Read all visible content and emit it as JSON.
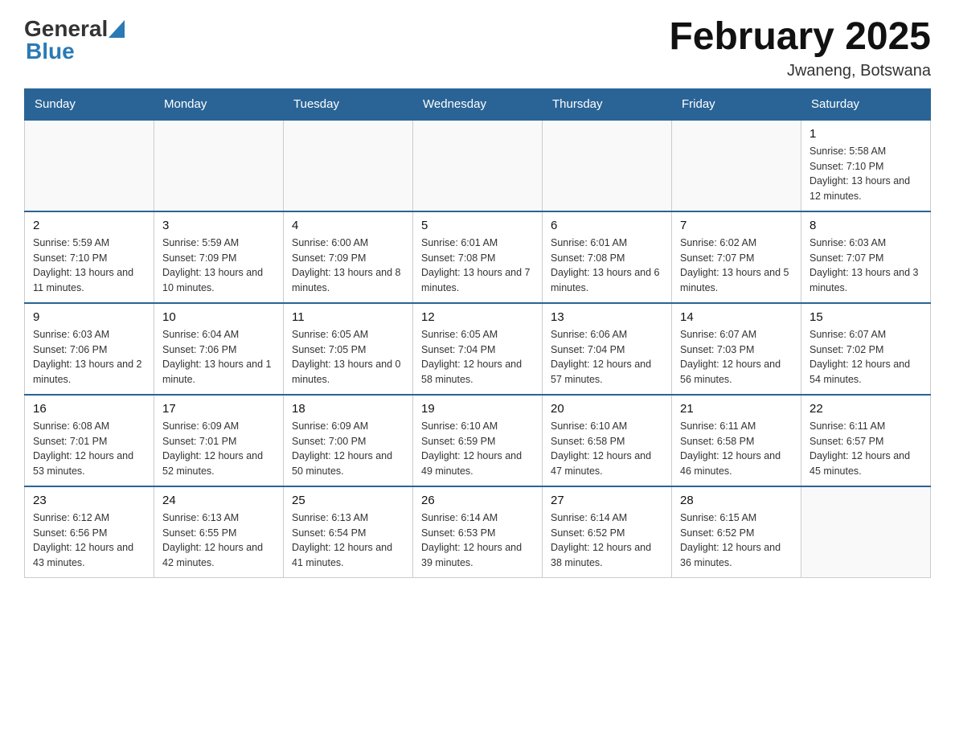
{
  "header": {
    "logo_general": "General",
    "logo_blue": "Blue",
    "title": "February 2025",
    "subtitle": "Jwaneng, Botswana"
  },
  "days_of_week": [
    "Sunday",
    "Monday",
    "Tuesday",
    "Wednesday",
    "Thursday",
    "Friday",
    "Saturday"
  ],
  "weeks": [
    [
      {
        "day": "",
        "info": ""
      },
      {
        "day": "",
        "info": ""
      },
      {
        "day": "",
        "info": ""
      },
      {
        "day": "",
        "info": ""
      },
      {
        "day": "",
        "info": ""
      },
      {
        "day": "",
        "info": ""
      },
      {
        "day": "1",
        "info": "Sunrise: 5:58 AM\nSunset: 7:10 PM\nDaylight: 13 hours and 12 minutes."
      }
    ],
    [
      {
        "day": "2",
        "info": "Sunrise: 5:59 AM\nSunset: 7:10 PM\nDaylight: 13 hours and 11 minutes."
      },
      {
        "day": "3",
        "info": "Sunrise: 5:59 AM\nSunset: 7:09 PM\nDaylight: 13 hours and 10 minutes."
      },
      {
        "day": "4",
        "info": "Sunrise: 6:00 AM\nSunset: 7:09 PM\nDaylight: 13 hours and 8 minutes."
      },
      {
        "day": "5",
        "info": "Sunrise: 6:01 AM\nSunset: 7:08 PM\nDaylight: 13 hours and 7 minutes."
      },
      {
        "day": "6",
        "info": "Sunrise: 6:01 AM\nSunset: 7:08 PM\nDaylight: 13 hours and 6 minutes."
      },
      {
        "day": "7",
        "info": "Sunrise: 6:02 AM\nSunset: 7:07 PM\nDaylight: 13 hours and 5 minutes."
      },
      {
        "day": "8",
        "info": "Sunrise: 6:03 AM\nSunset: 7:07 PM\nDaylight: 13 hours and 3 minutes."
      }
    ],
    [
      {
        "day": "9",
        "info": "Sunrise: 6:03 AM\nSunset: 7:06 PM\nDaylight: 13 hours and 2 minutes."
      },
      {
        "day": "10",
        "info": "Sunrise: 6:04 AM\nSunset: 7:06 PM\nDaylight: 13 hours and 1 minute."
      },
      {
        "day": "11",
        "info": "Sunrise: 6:05 AM\nSunset: 7:05 PM\nDaylight: 13 hours and 0 minutes."
      },
      {
        "day": "12",
        "info": "Sunrise: 6:05 AM\nSunset: 7:04 PM\nDaylight: 12 hours and 58 minutes."
      },
      {
        "day": "13",
        "info": "Sunrise: 6:06 AM\nSunset: 7:04 PM\nDaylight: 12 hours and 57 minutes."
      },
      {
        "day": "14",
        "info": "Sunrise: 6:07 AM\nSunset: 7:03 PM\nDaylight: 12 hours and 56 minutes."
      },
      {
        "day": "15",
        "info": "Sunrise: 6:07 AM\nSunset: 7:02 PM\nDaylight: 12 hours and 54 minutes."
      }
    ],
    [
      {
        "day": "16",
        "info": "Sunrise: 6:08 AM\nSunset: 7:01 PM\nDaylight: 12 hours and 53 minutes."
      },
      {
        "day": "17",
        "info": "Sunrise: 6:09 AM\nSunset: 7:01 PM\nDaylight: 12 hours and 52 minutes."
      },
      {
        "day": "18",
        "info": "Sunrise: 6:09 AM\nSunset: 7:00 PM\nDaylight: 12 hours and 50 minutes."
      },
      {
        "day": "19",
        "info": "Sunrise: 6:10 AM\nSunset: 6:59 PM\nDaylight: 12 hours and 49 minutes."
      },
      {
        "day": "20",
        "info": "Sunrise: 6:10 AM\nSunset: 6:58 PM\nDaylight: 12 hours and 47 minutes."
      },
      {
        "day": "21",
        "info": "Sunrise: 6:11 AM\nSunset: 6:58 PM\nDaylight: 12 hours and 46 minutes."
      },
      {
        "day": "22",
        "info": "Sunrise: 6:11 AM\nSunset: 6:57 PM\nDaylight: 12 hours and 45 minutes."
      }
    ],
    [
      {
        "day": "23",
        "info": "Sunrise: 6:12 AM\nSunset: 6:56 PM\nDaylight: 12 hours and 43 minutes."
      },
      {
        "day": "24",
        "info": "Sunrise: 6:13 AM\nSunset: 6:55 PM\nDaylight: 12 hours and 42 minutes."
      },
      {
        "day": "25",
        "info": "Sunrise: 6:13 AM\nSunset: 6:54 PM\nDaylight: 12 hours and 41 minutes."
      },
      {
        "day": "26",
        "info": "Sunrise: 6:14 AM\nSunset: 6:53 PM\nDaylight: 12 hours and 39 minutes."
      },
      {
        "day": "27",
        "info": "Sunrise: 6:14 AM\nSunset: 6:52 PM\nDaylight: 12 hours and 38 minutes."
      },
      {
        "day": "28",
        "info": "Sunrise: 6:15 AM\nSunset: 6:52 PM\nDaylight: 12 hours and 36 minutes."
      },
      {
        "day": "",
        "info": ""
      }
    ]
  ]
}
